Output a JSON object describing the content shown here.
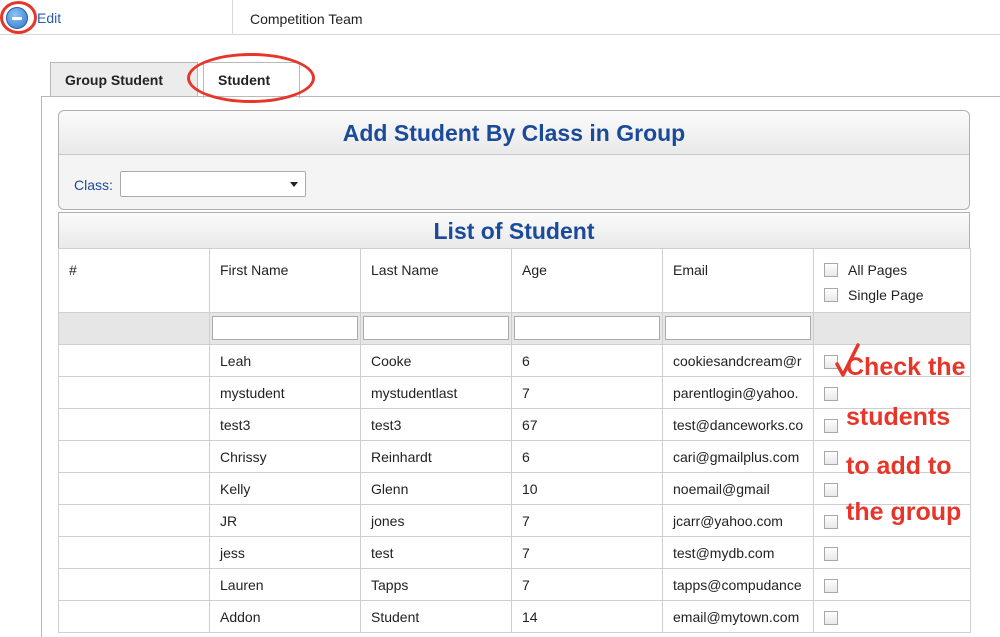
{
  "topbar": {
    "edit_label": "Edit",
    "title": "Competition Team"
  },
  "tabs": [
    {
      "label": "Group Student"
    },
    {
      "label": "Student"
    }
  ],
  "add_box": {
    "title": "Add Student By Class in Group",
    "class_label": "Class:",
    "class_value": ""
  },
  "list": {
    "title": "List of Student",
    "columns": [
      "#",
      "First Name",
      "Last Name",
      "Age",
      "Email"
    ],
    "select_options": [
      "All Pages",
      "Single Page"
    ],
    "rows": [
      {
        "num": "",
        "first": "Leah",
        "last": "Cooke",
        "age": "6",
        "email": "cookiesandcream@r"
      },
      {
        "num": "",
        "first": "mystudent",
        "last": "mystudentlast",
        "age": "7",
        "email": "parentlogin@yahoo."
      },
      {
        "num": "",
        "first": "test3",
        "last": "test3",
        "age": "67",
        "email": "test@danceworks.co"
      },
      {
        "num": "",
        "first": "Chrissy",
        "last": "Reinhardt",
        "age": "6",
        "email": "cari@gmailplus.com"
      },
      {
        "num": "",
        "first": "Kelly",
        "last": "Glenn",
        "age": "10",
        "email": "noemail@gmail"
      },
      {
        "num": "",
        "first": "JR",
        "last": "jones",
        "age": "7",
        "email": "jcarr@yahoo.com"
      },
      {
        "num": "",
        "first": "jess",
        "last": "test",
        "age": "7",
        "email": "test@mydb.com"
      },
      {
        "num": "",
        "first": "Lauren",
        "last": "Tapps",
        "age": "7",
        "email": "tapps@compudance"
      },
      {
        "num": "",
        "first": "Addon",
        "last": "Student",
        "age": "14",
        "email": "email@mytown.com"
      }
    ]
  },
  "annotation": {
    "lines": [
      "Check the",
      "students",
      "to add to",
      "the group"
    ]
  },
  "colors": {
    "accent": "#1a4a99",
    "annotation": "#e8352a",
    "link": "#2a5db0"
  }
}
